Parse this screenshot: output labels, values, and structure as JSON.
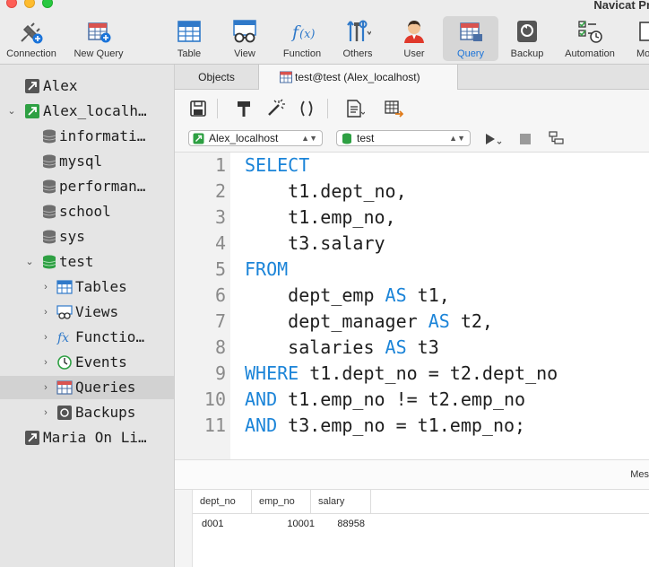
{
  "window": {
    "title": "Navicat Pr"
  },
  "toolbar": {
    "buttons": [
      {
        "label": "Connection",
        "icon": "connection-plug-icon"
      },
      {
        "label": "New Query",
        "icon": "new-query-grid-icon"
      },
      {
        "label": "Table",
        "icon": "table-grid-icon"
      },
      {
        "label": "View",
        "icon": "view-glasses-icon"
      },
      {
        "label": "Function",
        "icon": "function-fx-icon"
      },
      {
        "label": "Others",
        "icon": "tools-icon"
      },
      {
        "label": "User",
        "icon": "user-icon"
      },
      {
        "label": "Query",
        "icon": "query-grid-icon",
        "active": true
      },
      {
        "label": "Backup",
        "icon": "backup-icon"
      },
      {
        "label": "Automation",
        "icon": "automation-checklist-icon"
      },
      {
        "label": "Mo",
        "icon": "more-icon"
      }
    ]
  },
  "sidebar": {
    "items": [
      {
        "label": "Alex",
        "icon": "connection-icon"
      },
      {
        "label": "Alex_localhost",
        "icon": "connection-active-icon",
        "expanded": true
      },
      {
        "label": "information_schema",
        "icon": "database-icon"
      },
      {
        "label": "mysql",
        "icon": "database-icon"
      },
      {
        "label": "performance_schema",
        "icon": "database-icon"
      },
      {
        "label": "school",
        "icon": "database-icon"
      },
      {
        "label": "sys",
        "icon": "database-icon"
      },
      {
        "label": "test",
        "icon": "database-active-icon",
        "expanded": true
      },
      {
        "label": "Tables",
        "icon": "tables-icon"
      },
      {
        "label": "Views",
        "icon": "views-icon"
      },
      {
        "label": "Functions",
        "icon": "functions-icon"
      },
      {
        "label": "Events",
        "icon": "events-clock-icon"
      },
      {
        "label": "Queries",
        "icon": "queries-icon",
        "selected": true
      },
      {
        "label": "Backups",
        "icon": "backups-icon"
      },
      {
        "label": "Maria On Linux",
        "icon": "connection-icon"
      }
    ]
  },
  "tabs": [
    {
      "label": "Objects"
    },
    {
      "label": "test@test (Alex_localhost)",
      "active": true
    }
  ],
  "query_toolbar": {
    "connection_select": "Alex_localhost",
    "database_select": "test"
  },
  "editor": {
    "lines": [
      {
        "num": "1",
        "kw": "SELECT",
        "rest": ""
      },
      {
        "num": "2",
        "kw": "",
        "rest": "    t1.dept_no,"
      },
      {
        "num": "3",
        "kw": "",
        "rest": "    t1.emp_no,"
      },
      {
        "num": "4",
        "kw": "",
        "rest": "    t3.salary"
      },
      {
        "num": "5",
        "kw": "FROM",
        "rest": ""
      },
      {
        "num": "6",
        "kw": "",
        "rest": "    dept_emp ",
        "kw2": "AS",
        "rest2": " t1,"
      },
      {
        "num": "7",
        "kw": "",
        "rest": "    dept_manager ",
        "kw2": "AS",
        "rest2": " t2,"
      },
      {
        "num": "8",
        "kw": "",
        "rest": "    salaries ",
        "kw2": "AS",
        "rest2": " t3"
      },
      {
        "num": "9",
        "kw": "WHERE",
        "rest": " t1.dept_no = t2.dept_no"
      },
      {
        "num": "10",
        "kw": "AND",
        "rest": " t1.emp_no != t2.emp_no"
      },
      {
        "num": "11",
        "kw": "AND",
        "rest": " t3.emp_no = t1.emp_no;"
      }
    ]
  },
  "results": {
    "message_tab": "Mes",
    "columns": [
      "dept_no",
      "emp_no",
      "salary"
    ],
    "rows": [
      [
        "d001",
        "10001",
        "88958"
      ]
    ]
  },
  "colors": {
    "keyword": "#1b84d8",
    "active_tab_text": "#1a73d9"
  }
}
